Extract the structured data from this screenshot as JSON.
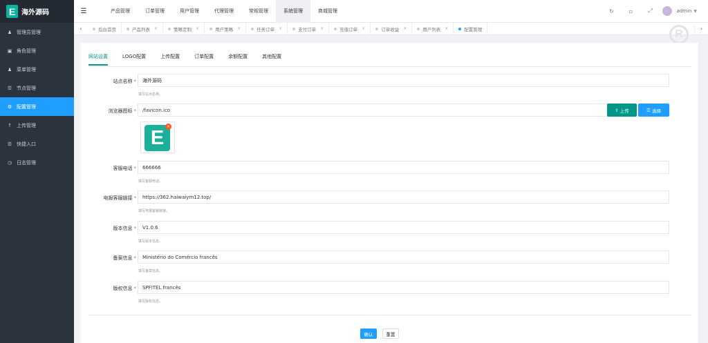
{
  "brand": {
    "logo_letter": "E",
    "name": "海外源码"
  },
  "sidebar": {
    "items": [
      {
        "label": "管理员管理",
        "icon": "user-icon"
      },
      {
        "label": "角色管理",
        "icon": "id-card-icon"
      },
      {
        "label": "菜单管理",
        "icon": "user-icon"
      },
      {
        "label": "节点管理",
        "icon": "list-icon"
      },
      {
        "label": "配置管理",
        "icon": "gear-icon",
        "active": true
      },
      {
        "label": "上传管理",
        "icon": "upload-icon"
      },
      {
        "label": "快捷入口",
        "icon": "list-icon"
      },
      {
        "label": "日志管理",
        "icon": "clock-icon"
      }
    ]
  },
  "topnav": {
    "items": [
      {
        "label": "产品管理"
      },
      {
        "label": "订单管理"
      },
      {
        "label": "用户管理"
      },
      {
        "label": "代理管理"
      },
      {
        "label": "常规管理"
      },
      {
        "label": "系统管理",
        "active": true
      },
      {
        "label": "商城管理"
      }
    ],
    "admin_name": "admin"
  },
  "tabs": [
    {
      "label": "后台首页"
    },
    {
      "label": "产品列表"
    },
    {
      "label": "策略定制"
    },
    {
      "label": "用户策略"
    },
    {
      "label": "任务订单"
    },
    {
      "label": "支付订单"
    },
    {
      "label": "充值订单"
    },
    {
      "label": "订单收益"
    },
    {
      "label": "用户列表"
    },
    {
      "label": "配置管理",
      "active": true
    }
  ],
  "subtabs": [
    "网站设置",
    "LOGO配置",
    "上传配置",
    "订单配置",
    "余额配置",
    "其他配置"
  ],
  "form": {
    "site_name": {
      "label": "站点名称",
      "value": "海外源码",
      "hint": "填写站点名称。"
    },
    "favicon": {
      "label": "浏览器图标",
      "value": "/favicon.ico",
      "upload": "上传",
      "select": "选择",
      "thumb_letter": "E",
      "thumb_close": "×"
    },
    "service_phone": {
      "label": "客服电话",
      "value": "666666",
      "hint": "填写客服电话。"
    },
    "service_link": {
      "label": "电报客服链接",
      "value": "https://362.haiwaiym12.top/",
      "hint": "填写电报客服链接。"
    },
    "version": {
      "label": "版本信息",
      "value": "V1.0.6",
      "hint": "填写版本信息。"
    },
    "record": {
      "label": "备案信息",
      "value": "Ministério do Comércio francês",
      "hint": "填写备案信息。"
    },
    "copyright": {
      "label": "版权信息",
      "value": "SPFITEL francês",
      "hint": "填写版权信息。"
    }
  },
  "actions": {
    "confirm": "确认",
    "reset": "重置"
  },
  "watermark": "R",
  "colors": {
    "sidebar_bg": "#2b333e",
    "active_blue": "#1e9fff",
    "teal": "#009688",
    "required": "#ff5722"
  }
}
